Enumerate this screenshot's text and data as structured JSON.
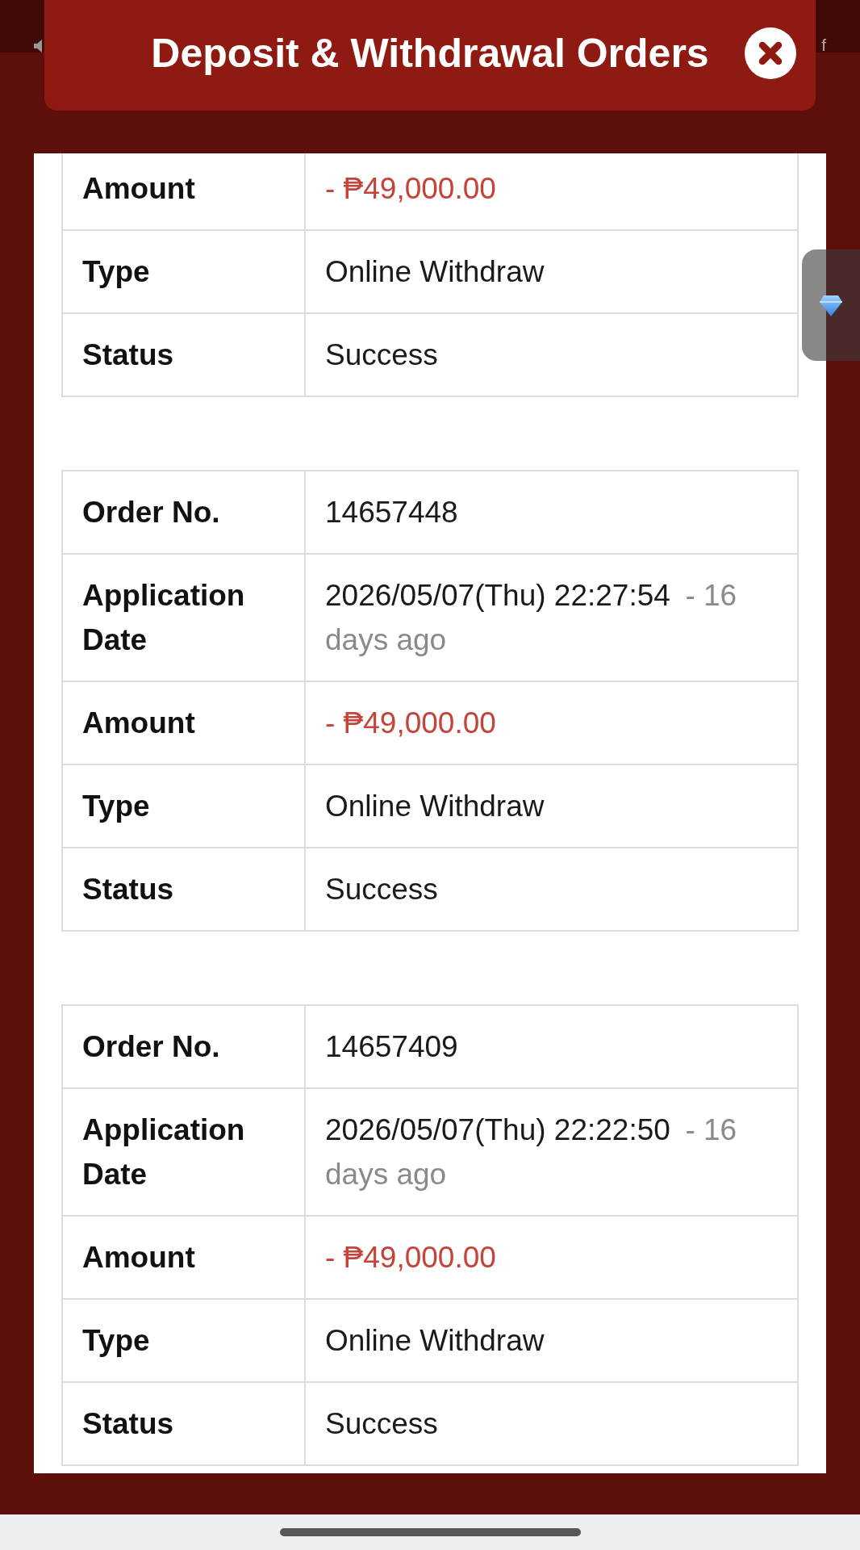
{
  "top_bar": {
    "marquee": "f"
  },
  "dialog": {
    "title": "Deposit & Withdrawal Orders"
  },
  "orders": [
    {
      "rows": [
        {
          "label": "Amount",
          "kind": "amount",
          "value": "- ₱49,000.00"
        },
        {
          "label": "Type",
          "kind": "text",
          "value": "Online Withdraw"
        },
        {
          "label": "Status",
          "kind": "text",
          "value": "Success"
        }
      ]
    },
    {
      "rows": [
        {
          "label": "Order No.",
          "kind": "text",
          "value": "14657448"
        },
        {
          "label": "Application Date",
          "kind": "date",
          "value": "2026/05/07(Thu) 22:27:54",
          "ago": "- 16 days ago"
        },
        {
          "label": "Amount",
          "kind": "amount",
          "value": "- ₱49,000.00"
        },
        {
          "label": "Type",
          "kind": "text",
          "value": "Online Withdraw"
        },
        {
          "label": "Status",
          "kind": "text",
          "value": "Success"
        }
      ]
    },
    {
      "rows": [
        {
          "label": "Order No.",
          "kind": "text",
          "value": "14657409"
        },
        {
          "label": "Application Date",
          "kind": "date",
          "value": "2026/05/07(Thu) 22:22:50",
          "ago": "- 16 days ago"
        },
        {
          "label": "Amount",
          "kind": "amount",
          "value": "- ₱49,000.00"
        },
        {
          "label": "Type",
          "kind": "text",
          "value": "Online Withdraw"
        },
        {
          "label": "Status",
          "kind": "text",
          "value": "Success"
        }
      ]
    }
  ]
}
